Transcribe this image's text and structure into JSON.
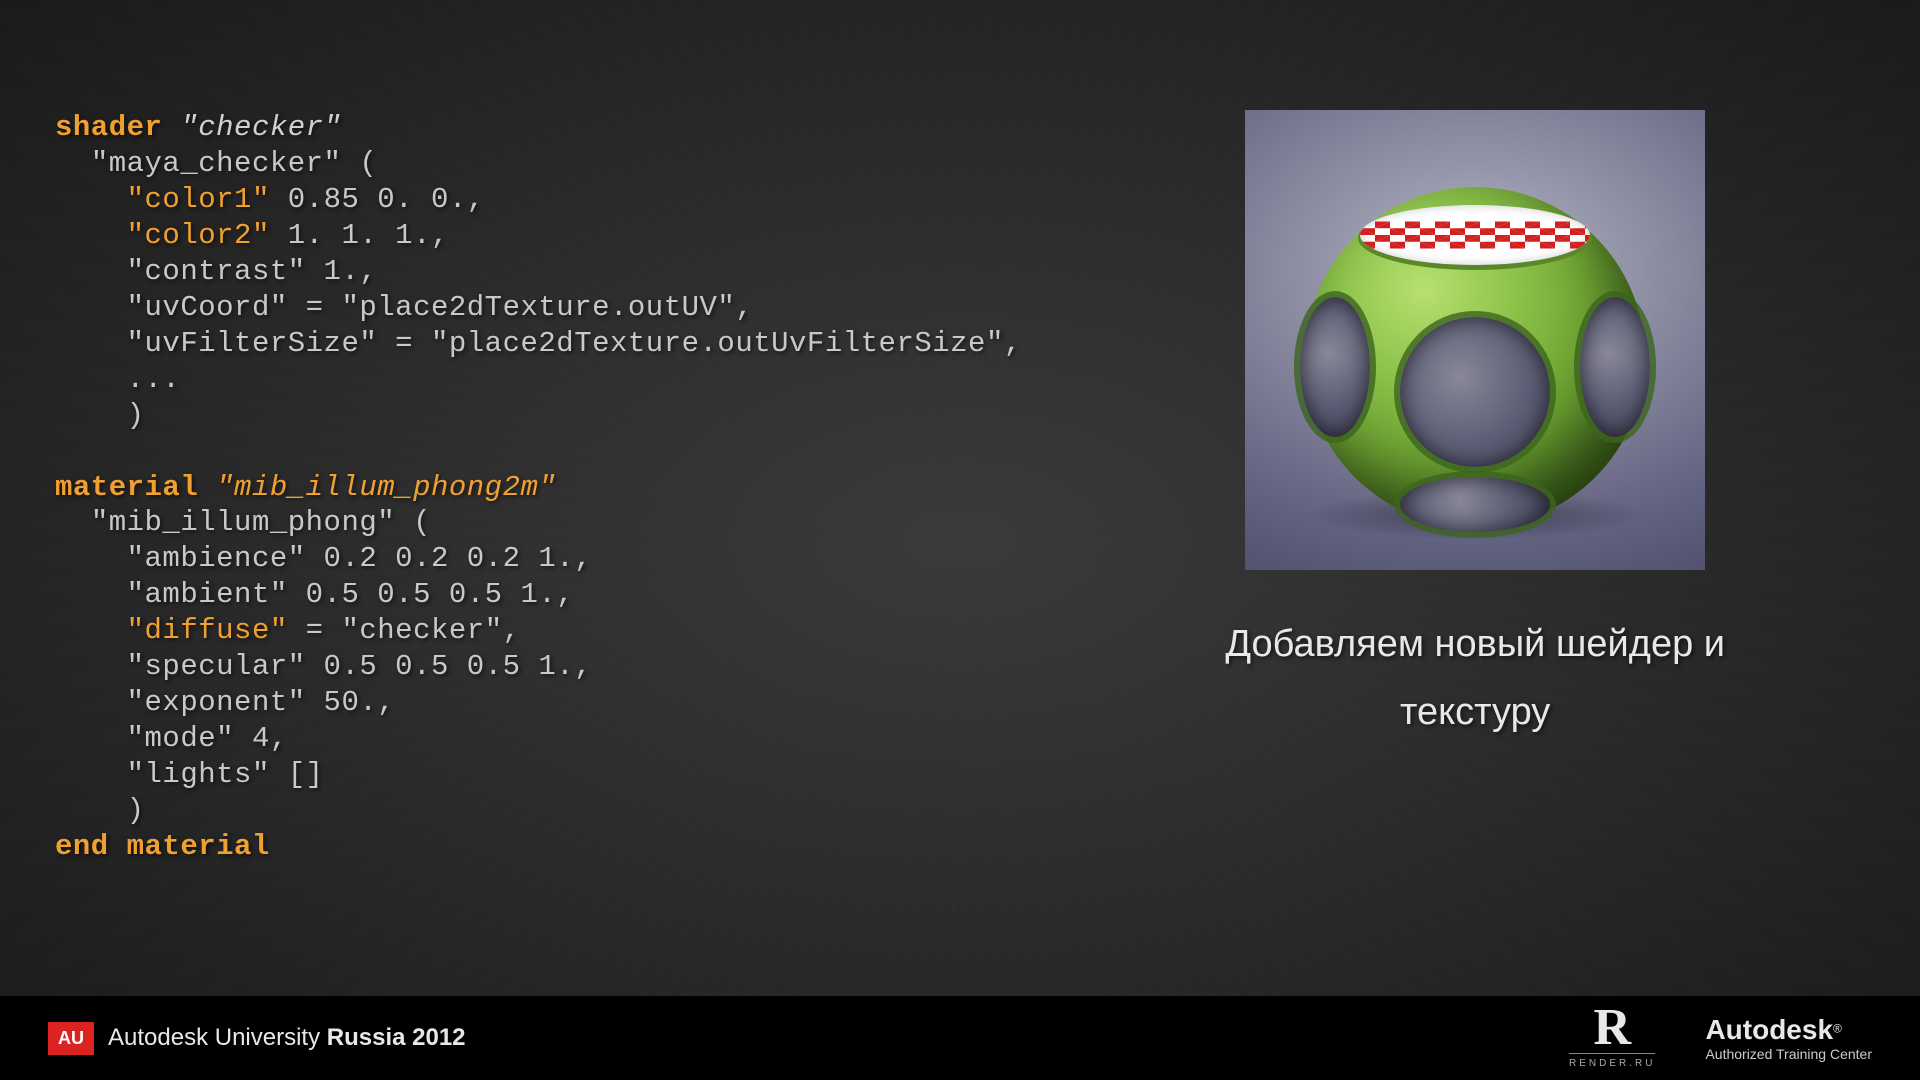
{
  "code": {
    "shader_kw": "shader",
    "shader_name": "\"checker\"",
    "shader_impl": "\"maya_checker\" (",
    "color1_key": "\"color1\"",
    "color1_val": " 0.85 0. 0.,",
    "color2_key": "\"color2\"",
    "color2_val": " 1. 1. 1.,",
    "contrast": "\"contrast\" 1.,",
    "uvcoord": "\"uvCoord\" = \"place2dTexture.outUV\",",
    "uvfilter": "\"uvFilterSize\" = \"place2dTexture.outUvFilterSize\",",
    "ellipsis": "...",
    "close1": ")",
    "material_kw": "material",
    "material_name": "\"mib_illum_phong2m\"",
    "material_impl": "\"mib_illum_phong\" (",
    "ambience": "\"ambience\" 0.2 0.2 0.2 1.,",
    "ambient": "\"ambient\" 0.5 0.5 0.5 1.,",
    "diffuse_key": "\"diffuse\"",
    "diffuse_val": " = \"checker\",",
    "specular": "\"specular\" 0.5 0.5 0.5 1.,",
    "exponent": "\"exponent\" 50.,",
    "mode": "\"mode\" 4,",
    "lights": "\"lights\" []",
    "close2": ")",
    "end_kw": "end material"
  },
  "caption_line1": "Добавляем новый шейдер и",
  "caption_line2": "текстуру",
  "footer": {
    "au_badge": "AU",
    "au_text_pre": "Autodesk University ",
    "au_text_bold": "Russia 2012",
    "render_r": "R",
    "render_sub": "RENDER.RU",
    "autodesk": "Autodesk",
    "reg": "®",
    "autodesk_sub": "Authorized Training Center"
  }
}
